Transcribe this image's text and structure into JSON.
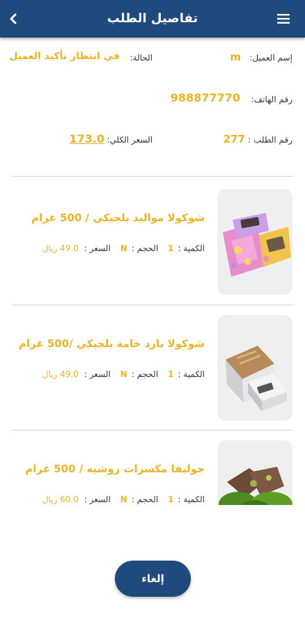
{
  "appbar": {
    "title": "تفاصيل الطلب"
  },
  "order": {
    "customer_label": "إسم العميل:",
    "customer_value": "m",
    "status_label": "الحالة:",
    "status_value": "في انتظار تأكيد العميل",
    "phone_label": "رقم الهاتف:",
    "phone_value": "988877770",
    "order_no_label": "رقم الطلب :",
    "order_no_value": "277",
    "total_label": "السعر الكلي:",
    "total_value": "173.0"
  },
  "products": [
    {
      "name": "شوكولا مواليد بلجيكي / 500 غرام",
      "qty_label": "الكمية :",
      "qty_value": "1",
      "size_label": "الحجم :",
      "size_value": "N",
      "price_label": "السعر :",
      "price_value": "49.0 ريال"
    },
    {
      "name": "شوكولا بارد خامة بلجيكي /500 غرام",
      "qty_label": "الكمية :",
      "qty_value": "1",
      "size_label": "الحجم :",
      "size_value": "N",
      "price_label": "السعر :",
      "price_value": "49.0 ريال"
    },
    {
      "name": "جوليفا مكسرات روشيه / 500 غرام",
      "qty_label": "الكمية :",
      "qty_value": "1",
      "size_label": "الحجم :",
      "size_value": "N",
      "price_label": "السعر :",
      "price_value": "60.0 ريال"
    }
  ],
  "actions": {
    "cancel_label": "إلغاء"
  },
  "colors": {
    "primary": "#1f4a7e",
    "accent": "#e8b528"
  },
  "icons": {
    "back": "chevron-left-icon",
    "menu": "hamburger-menu-icon"
  }
}
